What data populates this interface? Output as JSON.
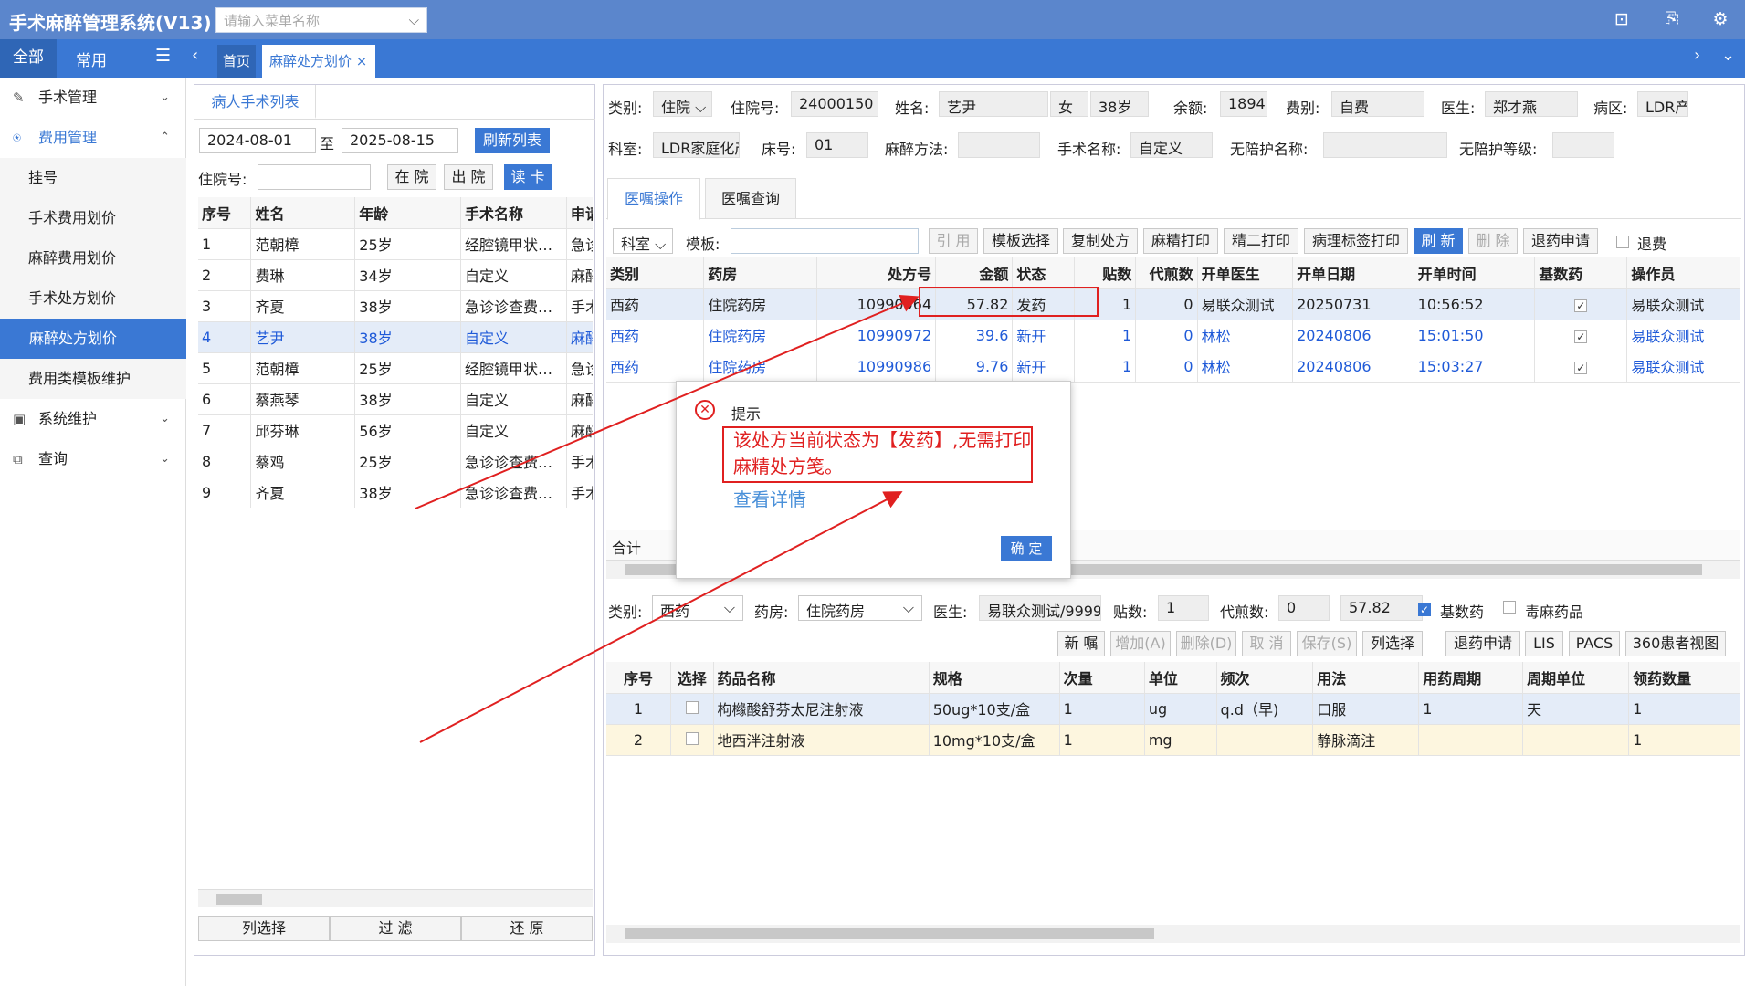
{
  "app": {
    "title": "手术麻醉管理系统(V13)",
    "menu_search_placeholder": "请输入菜单名称"
  },
  "nav": {
    "tab_all": "全部",
    "tab_common": "常用",
    "tab_home": "首页",
    "tab_active": "麻醉处方划价",
    "close": "×"
  },
  "sidebar": {
    "items": [
      {
        "label": "手术管理",
        "icon": "pen-icon"
      },
      {
        "label": "费用管理",
        "icon": "money-icon"
      },
      {
        "label": "挂号"
      },
      {
        "label": "手术费用划价"
      },
      {
        "label": "麻醉费用划价"
      },
      {
        "label": "手术处方划价"
      },
      {
        "label": "麻醉处方划价"
      },
      {
        "label": "费用类模板维护"
      },
      {
        "label": "系统维护",
        "icon": "monitor-icon"
      },
      {
        "label": "查询",
        "icon": "search-doc-icon"
      }
    ]
  },
  "left_panel": {
    "tab": "病人手术列表",
    "date_from": "2024-08-01",
    "to": "至",
    "date_to": "2025-08-15",
    "refresh": "刷新列表",
    "inpatient_label": "住院号:",
    "btn_in": "在 院",
    "btn_out": "出 院",
    "btn_read": "读 卡",
    "columns": [
      "序号",
      "姓名",
      "年龄",
      "手术名称",
      "申请"
    ],
    "rows": [
      [
        "1",
        "范朝樟",
        "25岁",
        "经腔镜甲状…",
        "急诊"
      ],
      [
        "2",
        "费琳",
        "34岁",
        "自定义",
        "麻醉"
      ],
      [
        "3",
        "齐夏",
        "38岁",
        "急诊诊查费…",
        "手术"
      ],
      [
        "4",
        "艺尹",
        "38岁",
        "自定义",
        "麻醉"
      ],
      [
        "5",
        "范朝樟",
        "25岁",
        "经腔镜甲状…",
        "急诊"
      ],
      [
        "6",
        "蔡燕琴",
        "38岁",
        "自定义",
        "麻醉"
      ],
      [
        "7",
        "邱芬琳",
        "56岁",
        "自定义",
        "麻醉"
      ],
      [
        "8",
        "蔡鸡",
        "25岁",
        "急诊诊查费…",
        "手术"
      ],
      [
        "9",
        "齐夏",
        "38岁",
        "急诊诊查费…",
        "手术"
      ]
    ],
    "footer": [
      "列选择",
      "过 滤",
      "还 原"
    ]
  },
  "patient": {
    "type_label": "类别:",
    "type": "住院",
    "inpatient_no_label": "住院号:",
    "inpatient_no": "24000150",
    "name_label": "姓名:",
    "name": "艺尹",
    "sex": "女",
    "age": "38岁",
    "balance_label": "余额:",
    "balance": "1894.",
    "fee_label": "费别:",
    "fee": "自费",
    "doctor_label": "医生:",
    "doctor": "郑才燕",
    "ward_label": "病区:",
    "ward": "LDR产",
    "dept_label": "科室:",
    "dept": "LDR家庭化产",
    "bed_label": "床号:",
    "bed": "01",
    "anes_label": "麻醉方法:",
    "anes": "",
    "op_label": "手术名称:",
    "op": "自定义",
    "nurse_label": "无陪护名称:",
    "nurse": "",
    "nurse_lv_label": "无陪护等级:",
    "nurse_lv": ""
  },
  "rx_tabs": [
    "医嘱操作",
    "医嘱查询"
  ],
  "rx_toolbar": {
    "dept": "科室",
    "template_label": "模板:",
    "template": "",
    "buttons": [
      "引 用",
      "模板选择",
      "复制处方",
      "麻精打印",
      "精二打印",
      "病理标签打印",
      "刷 新",
      "删 除",
      "退药申请"
    ],
    "refund": "退费"
  },
  "rx_table": {
    "columns": [
      "类别",
      "药房",
      "处方号",
      "金额",
      "状态",
      "贴数",
      "代煎数",
      "开单医生",
      "开单日期",
      "开单时间",
      "基数药",
      "操作员"
    ],
    "rows": [
      [
        "西药",
        "住院药房",
        "10990964",
        "57.82",
        "发药",
        "1",
        "0",
        "易联众测试",
        "20250731",
        "10:56:52",
        "✓",
        "易联众测试"
      ],
      [
        "西药",
        "住院药房",
        "10990972",
        "39.6",
        "新开",
        "1",
        "0",
        "林松",
        "20240806",
        "15:01:50",
        "✓",
        "易联众测试"
      ],
      [
        "西药",
        "住院药房",
        "10990986",
        "9.76",
        "新开",
        "1",
        "0",
        "林松",
        "20240806",
        "15:03:27",
        "✓",
        "易联众测试"
      ]
    ],
    "total_label": "合计"
  },
  "detail": {
    "type_label": "类别:",
    "type": "西药",
    "pharm_label": "药房:",
    "pharm": "住院药房",
    "doctor_label": "医生:",
    "doctor": "易联众测试/9999",
    "tie_label": "贴数:",
    "tie": "1",
    "daijian_label": "代煎数:",
    "daijian": "0",
    "amount": "57.82",
    "basic": "基数药",
    "toxic": "毒麻药品",
    "buttons": [
      "新 嘱",
      "增加(A)",
      "删除(D)",
      "取 消",
      "保存(S)",
      "列选择",
      "退药申请",
      "LIS",
      "PACS",
      "360患者视图"
    ]
  },
  "drug_table": {
    "columns": [
      "序号",
      "选择",
      "药品名称",
      "规格",
      "次量",
      "单位",
      "频次",
      "用法",
      "用药周期",
      "周期单位",
      "领药数量"
    ],
    "rows": [
      [
        "1",
        "",
        "枸橼酸舒芬太尼注射液",
        "50ug*10支/盒",
        "1",
        "ug",
        "q.d（早)",
        "口服",
        "1",
        "天",
        "1"
      ],
      [
        "2",
        "",
        "地西泮注射液",
        "10mg*10支/盒",
        "1",
        "mg",
        "",
        "静脉滴注",
        "",
        "",
        "1"
      ]
    ]
  },
  "dialog": {
    "title": "提示",
    "message": "该处方当前状态为【发药】,无需打印麻精处方笺。",
    "detail_link": "查看详情",
    "ok": "确 定"
  },
  "colors": {
    "topbar": "#5b86cc",
    "navbar": "#3a78d4",
    "annotation": "#e02020"
  }
}
